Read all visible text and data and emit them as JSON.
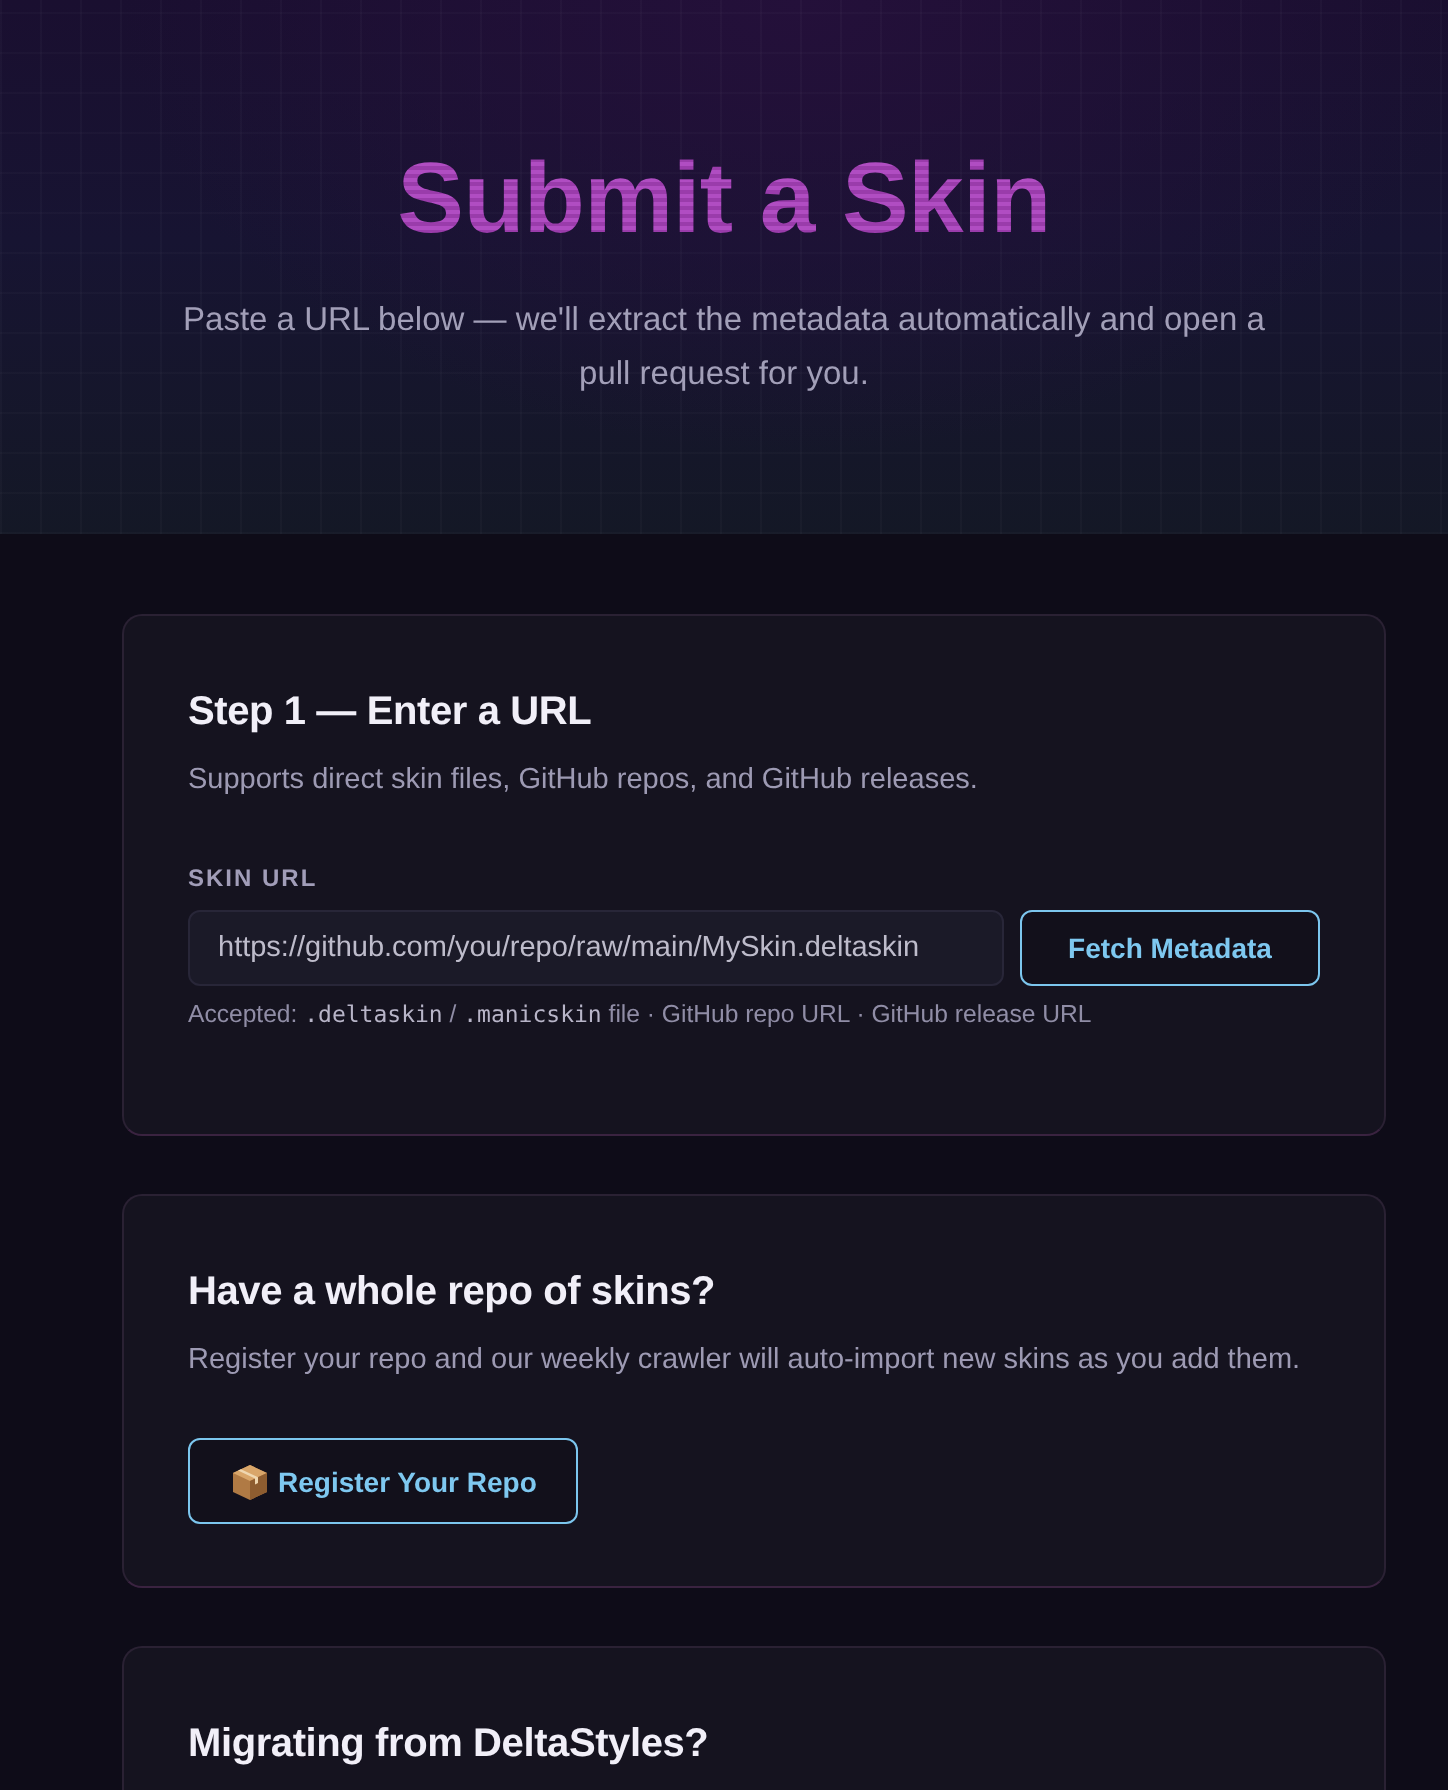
{
  "header": {
    "title": "Submit a Skin",
    "subtitle": "Paste a URL below — we'll extract the metadata automatically and open a pull request for you."
  },
  "cards": [
    {
      "kind": "url_form",
      "heading": "Step 1 — Enter a URL",
      "description": "Supports direct skin files, GitHub repos, and GitHub releases.",
      "field": {
        "label": "SKIN URL",
        "placeholder": "https://github.com/you/repo/raw/main/MySkin.deltaskin"
      },
      "button": "Fetch Metadata",
      "hint": [
        {
          "kind": "text",
          "text": "Accepted: "
        },
        {
          "kind": "code",
          "text": ".deltaskin"
        },
        {
          "kind": "text",
          "text": " / "
        },
        {
          "kind": "code",
          "text": ".manicskin"
        },
        {
          "kind": "text",
          "text": " file · GitHub repo URL · GitHub release URL"
        }
      ]
    },
    {
      "kind": "action",
      "heading": "Have a whole repo of skins?",
      "description": "Register your repo and our weekly crawler will auto-import new skins as you add them.",
      "button": "Register Your Repo"
    },
    {
      "kind": "action",
      "heading": "Migrating from DeltaStyles?"
    }
  ]
}
